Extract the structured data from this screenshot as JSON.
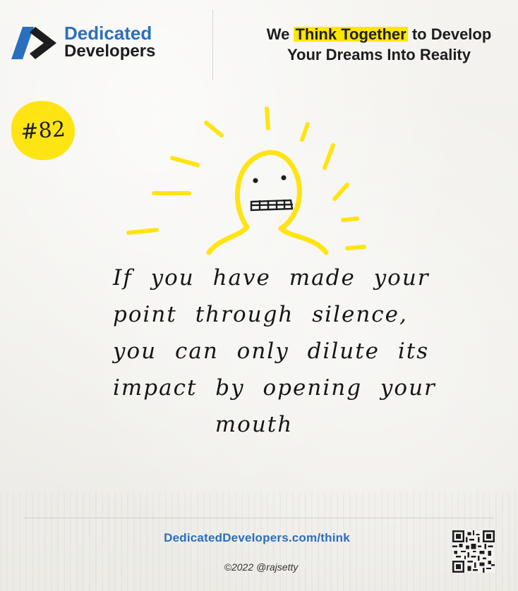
{
  "brand": {
    "name_line1": "Dedicated",
    "name_line2": "Developers",
    "primary_color": "#2a6fbd",
    "dark_color": "#1d1d1f",
    "icon": "dedicated-developers-logo"
  },
  "tagline": {
    "prefix": "We",
    "highlight": "Think Together",
    "line1_suffix": "to Develop",
    "line2": "Your Dreams Into Reality",
    "highlight_color": "#ffe600"
  },
  "badge": {
    "label": "#82",
    "color": "#ffe413"
  },
  "quote": {
    "lines": [
      "If you have made your",
      "point through silence,",
      "you can only dilute its",
      "impact by opening your",
      "mouth"
    ]
  },
  "footer": {
    "url": "DedicatedDevelopers.com/think",
    "copyright": "©2022 @rajsetty",
    "qr_icon": "qr-code-icon"
  }
}
